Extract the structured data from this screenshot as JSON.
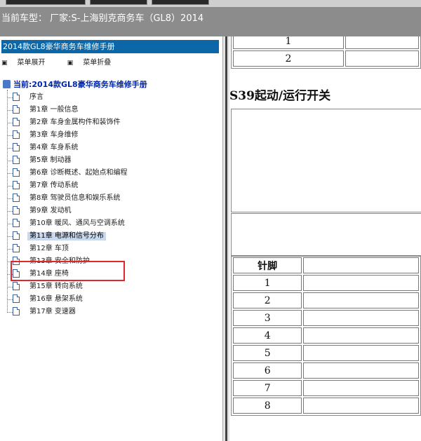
{
  "header": {
    "vehicle_label": "当前车型： 厂家:S-上海别克商务车（GL8）2014"
  },
  "sidebar": {
    "manual_title": "2014款GL8豪华商务车维修手册",
    "expand_label": "菜单展开",
    "collapse_label": "菜单折叠",
    "current_label": "当前:2014款GL8豪华商务车维修手册",
    "items": [
      {
        "label": "序言"
      },
      {
        "label": "第1章 一般信息"
      },
      {
        "label": "第2章 车身金属构件和装饰件"
      },
      {
        "label": "第3章 车身维修"
      },
      {
        "label": "第4章 车身系统"
      },
      {
        "label": "第5章 制动器"
      },
      {
        "label": "第6章 诊断概述、起始点和编程"
      },
      {
        "label": "第7章 传动系统"
      },
      {
        "label": "第8章 驾驶员信息和娱乐系统"
      },
      {
        "label": "第9章 发动机"
      },
      {
        "label": "第10章 暖风、通风与空调系统"
      },
      {
        "label": "第11章 电源和信号分布",
        "selected": true
      },
      {
        "label": "第12章 车顶"
      },
      {
        "label": "第13章 安全和防护"
      },
      {
        "label": "第14章 座椅"
      },
      {
        "label": "第15章 转向系统"
      },
      {
        "label": "第16章 悬架系统"
      },
      {
        "label": "第17章 变速器"
      }
    ]
  },
  "content": {
    "top_rows": [
      "1",
      "2"
    ],
    "section_title": "S39起动/运行开关",
    "pin_header": "针脚",
    "pins": [
      "1",
      "2",
      "3",
      "4",
      "5",
      "6",
      "7",
      "8"
    ]
  }
}
